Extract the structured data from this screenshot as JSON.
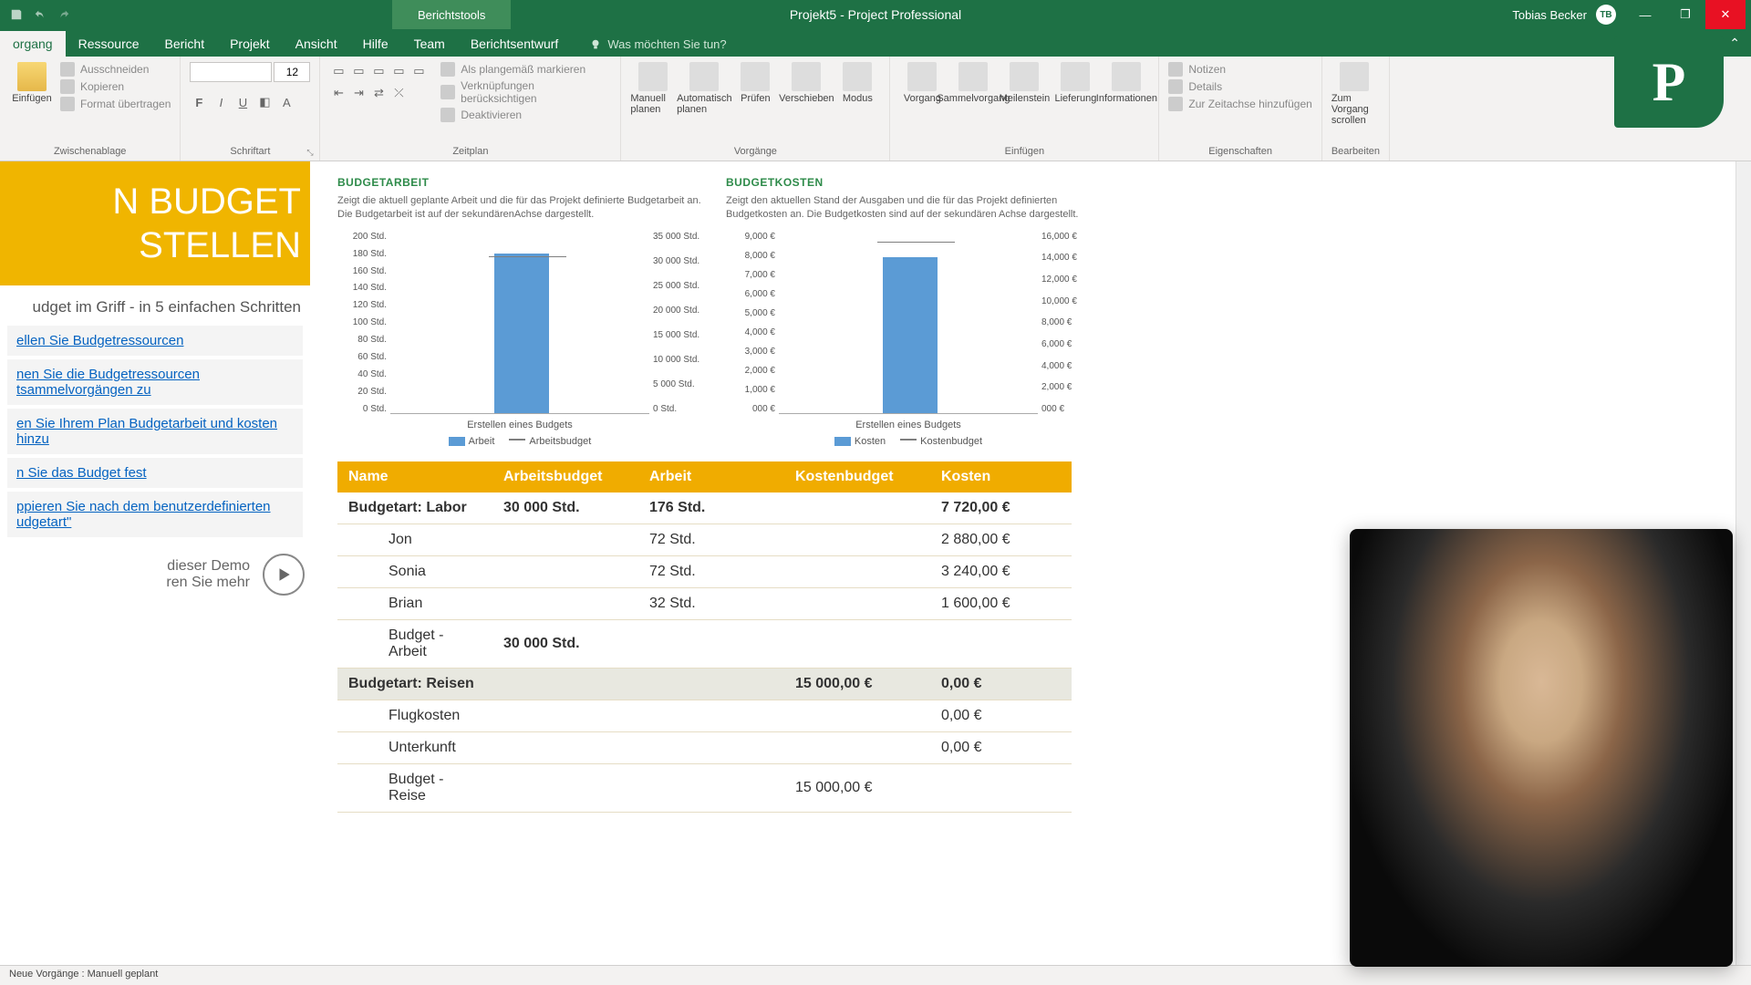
{
  "title_bar": {
    "context_tab": "Berichtstools",
    "document_title": "Projekt5 - Project Professional",
    "user_name": "Tobias Becker",
    "user_initials": "TB"
  },
  "ribbon_tabs": {
    "items": [
      "organg",
      "Ressource",
      "Bericht",
      "Projekt",
      "Ansicht",
      "Hilfe",
      "Team",
      "Berichtsentwurf"
    ],
    "tell_me": "Was möchten Sie tun?"
  },
  "ribbon": {
    "clipboard": {
      "paste": "Einfügen",
      "cut": "Ausschneiden",
      "copy": "Kopieren",
      "format_painter": "Format übertragen",
      "group_label": "Zwischenablage"
    },
    "font": {
      "size": "12",
      "group_label": "Schriftart"
    },
    "schedule": {
      "mark_on_track": "Als plangemäß markieren",
      "respect_links": "Verknüpfungen berücksichtigen",
      "deactivate": "Deaktivieren",
      "group_label": "Zeitplan"
    },
    "tasks": {
      "manual": "Manuell planen",
      "auto": "Automatisch planen",
      "inspect": "Prüfen",
      "move": "Verschieben",
      "mode": "Modus",
      "group_label": "Vorgänge"
    },
    "insert": {
      "task": "Vorgang",
      "summary": "Sammelvorgang",
      "milestone": "Meilenstein",
      "deliverable": "Lieferung",
      "information": "Informationen",
      "group_label": "Einfügen"
    },
    "properties": {
      "notes": "Notizen",
      "details": "Details",
      "timeline": "Zur Zeitachse hinzufügen",
      "group_label": "Eigenschaften"
    },
    "editing": {
      "scroll_to_task": "Zum Vorgang scrollen",
      "group_label": "Bearbeiten"
    }
  },
  "left_panel": {
    "title_line1": "N BUDGET",
    "title_line2": "STELLEN",
    "subtitle": "udget im Griff - in 5 einfachen Schritten",
    "links": [
      "ellen Sie Budgetressourcen",
      "nen Sie die Budgetressourcen tsammelvorgängen zu",
      "en Sie Ihrem Plan Budgetarbeit und kosten hinzu",
      "n Sie das Budget fest",
      "ppieren Sie nach dem benutzerdefinierten udgetart\""
    ],
    "demo_line1": "dieser Demo",
    "demo_line2": "ren Sie mehr"
  },
  "charts": {
    "left": {
      "title": "BUDGETARBEIT",
      "description": "Zeigt die aktuell geplante Arbeit und die für das Projekt definierte Budgetarbeit an. Die Budgetarbeit ist auf der sekundärenAchse dargestellt.",
      "left_axis": [
        "200 Std.",
        "180 Std.",
        "160 Std.",
        "140 Std.",
        "120 Std.",
        "100 Std.",
        "80 Std.",
        "60 Std.",
        "40 Std.",
        "20 Std.",
        "0 Std."
      ],
      "right_axis": [
        "35 000 Std.",
        "30 000 Std.",
        "25 000 Std.",
        "20 000 Std.",
        "15 000 Std.",
        "10 000 Std.",
        "5 000 Std.",
        "0 Std."
      ],
      "xlabel": "Erstellen eines Budgets",
      "legend1": "Arbeit",
      "legend2": "Arbeitsbudget"
    },
    "right": {
      "title": "BUDGETKOSTEN",
      "description": "Zeigt den aktuellen Stand der Ausgaben und die für das Projekt definierten Budgetkosten an. Die Budgetkosten sind auf der sekundären Achse dargestellt.",
      "left_axis": [
        "9,000 €",
        "8,000 €",
        "7,000 €",
        "6,000 €",
        "5,000 €",
        "4,000 €",
        "3,000 €",
        "2,000 €",
        "1,000 €",
        "000 €"
      ],
      "right_axis": [
        "16,000 €",
        "14,000 €",
        "12,000 €",
        "10,000 €",
        "8,000 €",
        "6,000 €",
        "4,000 €",
        "2,000 €",
        "000 €"
      ],
      "xlabel": "Erstellen eines Budgets",
      "legend1": "Kosten",
      "legend2": "Kostenbudget"
    }
  },
  "chart_data": [
    {
      "type": "bar",
      "title": "BUDGETARBEIT",
      "categories": [
        "Erstellen eines Budgets"
      ],
      "series": [
        {
          "name": "Arbeit",
          "values": [
            176
          ],
          "axis": "left",
          "unit": "Std."
        },
        {
          "name": "Arbeitsbudget",
          "values": [
            30000
          ],
          "axis": "right",
          "unit": "Std."
        }
      ],
      "y_left": {
        "label": "Std.",
        "lim": [
          0,
          200
        ]
      },
      "y_right": {
        "label": "Std.",
        "lim": [
          0,
          35000
        ]
      }
    },
    {
      "type": "bar",
      "title": "BUDGETKOSTEN",
      "categories": [
        "Erstellen eines Budgets"
      ],
      "series": [
        {
          "name": "Kosten",
          "values": [
            7720
          ],
          "axis": "left",
          "unit": "€"
        },
        {
          "name": "Kostenbudget",
          "values": [
            15000
          ],
          "axis": "right",
          "unit": "€"
        }
      ],
      "y_left": {
        "label": "€",
        "lim": [
          0,
          9000
        ]
      },
      "y_right": {
        "label": "€",
        "lim": [
          0,
          16000
        ]
      }
    }
  ],
  "table": {
    "headers": [
      "Name",
      "Arbeitsbudget",
      "Arbeit",
      "Kostenbudget",
      "Kosten"
    ],
    "rows": [
      {
        "type": "group-first",
        "cells": [
          "Budgetart: Labor",
          "30 000 Std.",
          "176 Std.",
          "",
          "7 720,00 €"
        ]
      },
      {
        "type": "item",
        "cells": [
          "Jon",
          "",
          "72 Std.",
          "",
          "2 880,00 €"
        ]
      },
      {
        "type": "item",
        "cells": [
          "Sonia",
          "",
          "72 Std.",
          "",
          "3 240,00 €"
        ]
      },
      {
        "type": "item",
        "cells": [
          "Brian",
          "",
          "32 Std.",
          "",
          "1 600,00 €"
        ]
      },
      {
        "type": "item",
        "cells": [
          "Budget - Arbeit",
          "30 000 Std.",
          "",
          "",
          ""
        ]
      },
      {
        "type": "group",
        "cells": [
          "Budgetart: Reisen",
          "",
          "",
          "15 000,00 €",
          "0,00 €"
        ]
      },
      {
        "type": "item",
        "cells": [
          "Flugkosten",
          "",
          "",
          "",
          "0,00 €"
        ]
      },
      {
        "type": "item",
        "cells": [
          "Unterkunft",
          "",
          "",
          "",
          "0,00 €"
        ]
      },
      {
        "type": "item",
        "cells": [
          "Budget - Reise",
          "",
          "",
          "15 000,00 €",
          ""
        ]
      }
    ]
  },
  "status_bar": {
    "text": "Neue Vorgänge : Manuell geplant"
  }
}
